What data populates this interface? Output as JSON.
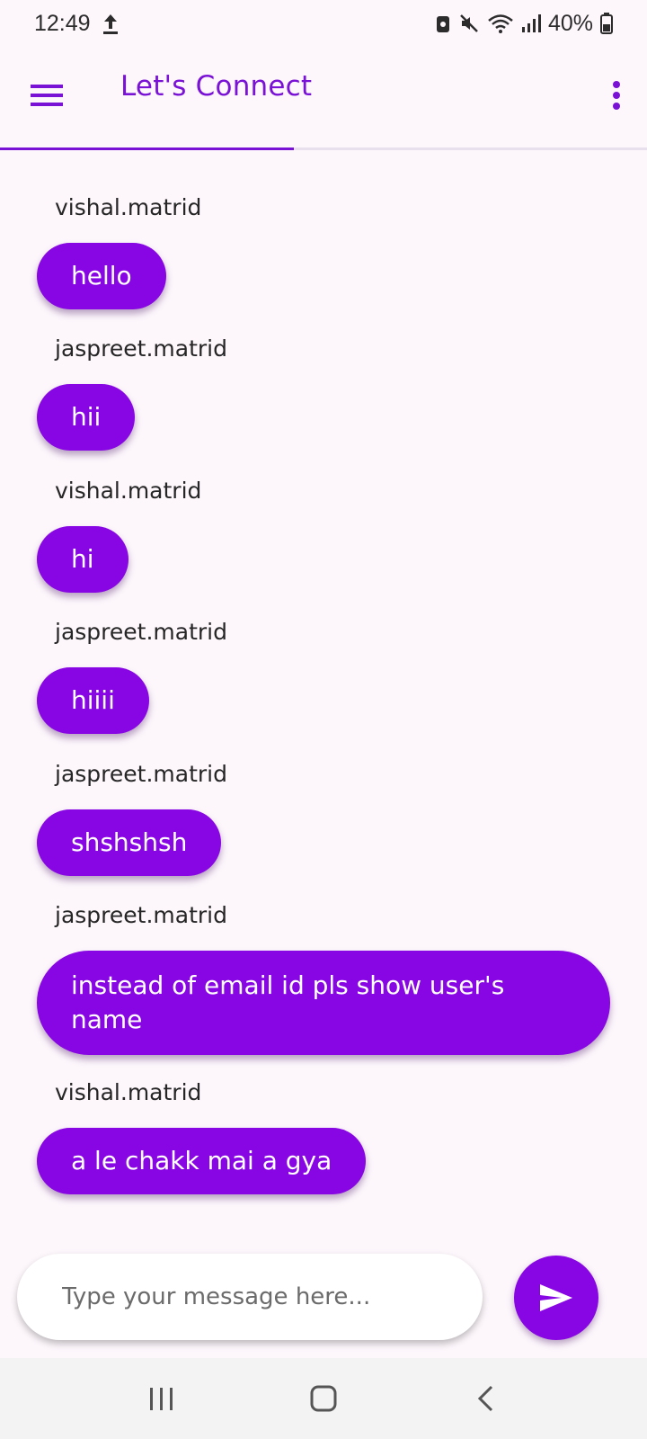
{
  "status_bar": {
    "time": "12:49",
    "battery": "40%"
  },
  "app_bar": {
    "title": "Let's Connect"
  },
  "messages": [
    {
      "sender": "vishal.matrid",
      "text": "hello"
    },
    {
      "sender": "jaspreet.matrid",
      "text": "hii"
    },
    {
      "sender": "vishal.matrid",
      "text": "hi"
    },
    {
      "sender": "jaspreet.matrid",
      "text": "hiiii"
    },
    {
      "sender": "jaspreet.matrid",
      "text": "shshshsh"
    },
    {
      "sender": "jaspreet.matrid",
      "text": "instead of email id pls show user's name"
    },
    {
      "sender": "vishal.matrid",
      "text": "a le chakk mai a gya"
    }
  ],
  "input": {
    "placeholder": "Type your message here..."
  },
  "colors": {
    "accent": "#8806e3",
    "title": "#7a12d6",
    "background": "#fdf7fc"
  },
  "icons": {
    "menu": "menu-icon",
    "more": "more-vert-icon",
    "send": "send-icon",
    "nav_recents": "recents-icon",
    "nav_home": "home-icon",
    "nav_back": "back-icon"
  }
}
